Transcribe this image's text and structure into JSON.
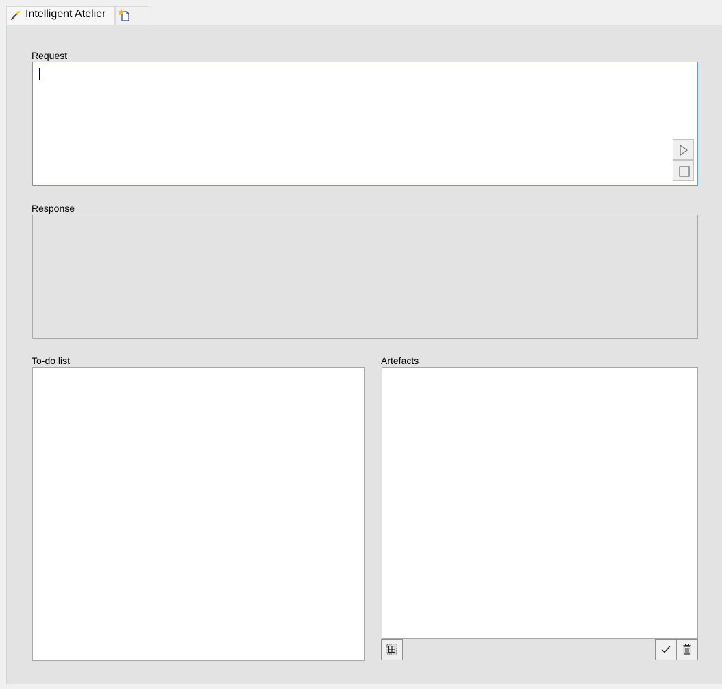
{
  "window": {
    "tabs": [
      {
        "label": "Intelligent Atelier",
        "icon": "magic-wand-icon",
        "active": true
      },
      {
        "label": "",
        "icon": "new-document-icon",
        "active": false
      }
    ]
  },
  "request": {
    "label": "Request",
    "value": "",
    "buttons": [
      {
        "icon": "play-icon"
      },
      {
        "icon": "stop-icon"
      }
    ]
  },
  "response": {
    "label": "Response",
    "value": ""
  },
  "todo": {
    "label": "To-do list",
    "items": []
  },
  "artefacts": {
    "label": "Artefacts",
    "items": [],
    "toolbar": [
      {
        "icon": "add-grid-icon"
      },
      {
        "icon": "checkmark-icon"
      },
      {
        "icon": "trash-icon"
      }
    ]
  },
  "colors": {
    "focus_border": "#5d9bd9",
    "panel_background": "#e3e3e3",
    "box_border": "#a8a8a8"
  }
}
